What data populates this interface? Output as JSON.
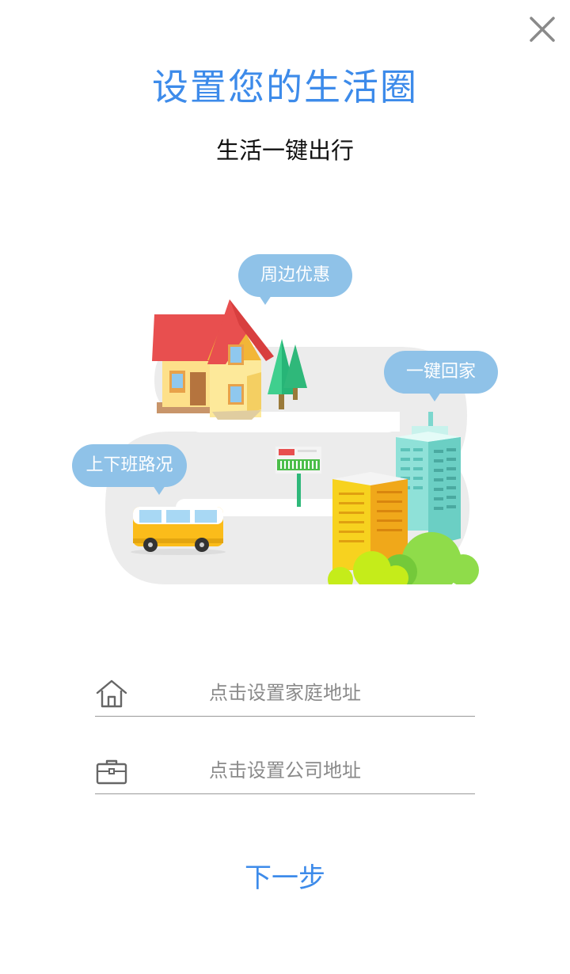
{
  "header": {
    "title": "设置您的生活圈",
    "subtitle": "生活一键出行"
  },
  "illustration": {
    "bubbles": {
      "discounts": "周边优惠",
      "go_home": "一键回家",
      "commute": "上下班路况"
    }
  },
  "form": {
    "home": {
      "placeholder": "点击设置家庭地址",
      "icon": "house-icon"
    },
    "company": {
      "placeholder": "点击设置公司地址",
      "icon": "briefcase-icon"
    }
  },
  "footer": {
    "next_label": "下一步"
  },
  "colors": {
    "accent": "#3d8bea",
    "bubble": "#8fc2e8"
  }
}
